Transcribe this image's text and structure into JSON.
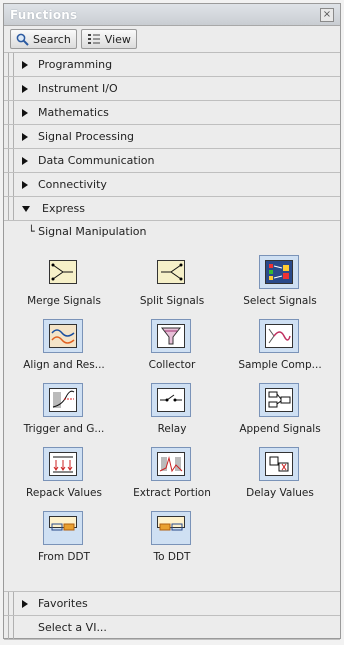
{
  "window": {
    "title": "Functions",
    "close_symbol": "×"
  },
  "toolbar": {
    "search_label": "Search",
    "view_label": "View"
  },
  "categories": [
    "Programming",
    "Instrument I/O",
    "Mathematics",
    "Signal Processing",
    "Data Communication",
    "Connectivity"
  ],
  "express": {
    "label": "Express",
    "subcategory": "Signal Manipulation",
    "items": [
      {
        "label": "Merge Signals"
      },
      {
        "label": "Split Signals"
      },
      {
        "label": "Select Signals"
      },
      {
        "label": "Align and Res..."
      },
      {
        "label": "Collector"
      },
      {
        "label": "Sample Comp..."
      },
      {
        "label": "Trigger and G..."
      },
      {
        "label": "Relay"
      },
      {
        "label": "Append Signals"
      },
      {
        "label": "Repack Values"
      },
      {
        "label": "Extract Portion"
      },
      {
        "label": "Delay Values"
      },
      {
        "label": "From DDT"
      },
      {
        "label": "To DDT"
      }
    ]
  },
  "footer": {
    "favorites": "Favorites",
    "select_vi": "Select a VI..."
  }
}
